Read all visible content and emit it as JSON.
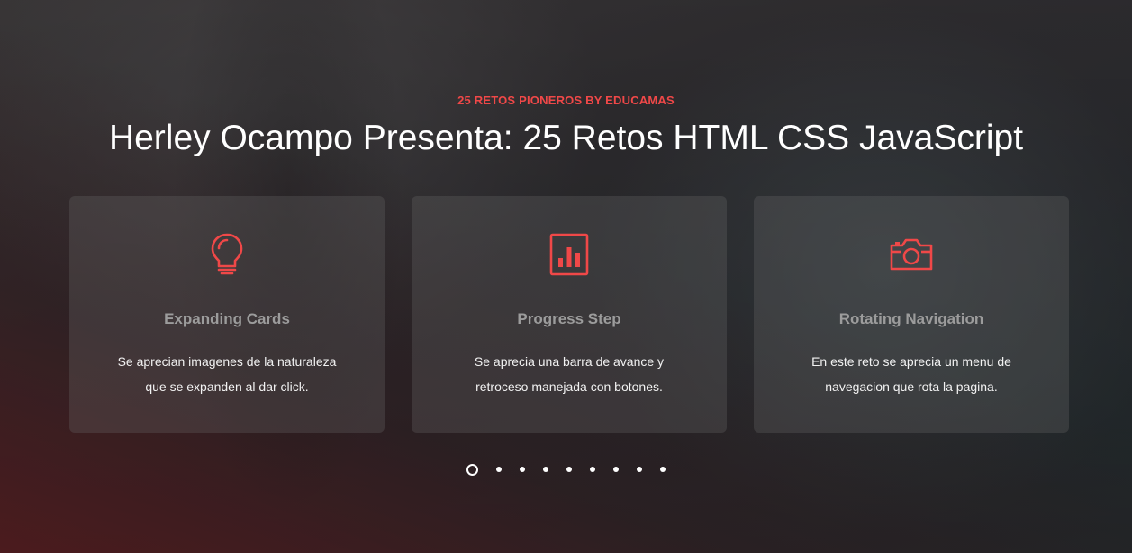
{
  "hero": {
    "eyebrow": "25 RETOS PIONEROS BY EDUCAMAS",
    "title": "Herley Ocampo Presenta: 25 Retos HTML CSS JavaScript"
  },
  "cards": [
    {
      "icon": "lightbulb-icon",
      "title": "Expanding Cards",
      "desc_line1": "Se aprecian imagenes de la naturaleza",
      "desc_line2": "que se expanden al dar click."
    },
    {
      "icon": "bar-chart-icon",
      "title": "Progress Step",
      "desc_line1": "Se aprecia una barra de avance y",
      "desc_line2": "retroceso manejada con botones."
    },
    {
      "icon": "camera-icon",
      "title": "Rotating Navigation",
      "desc_line1": "En este reto se aprecia un menu de",
      "desc_line2": "navegacion que rota la pagina."
    }
  ],
  "pagination": {
    "count": 9,
    "active_index": 0
  },
  "colors": {
    "accent": "#f04848",
    "text": "#ffffff",
    "card_title": "#9c9c9c"
  }
}
